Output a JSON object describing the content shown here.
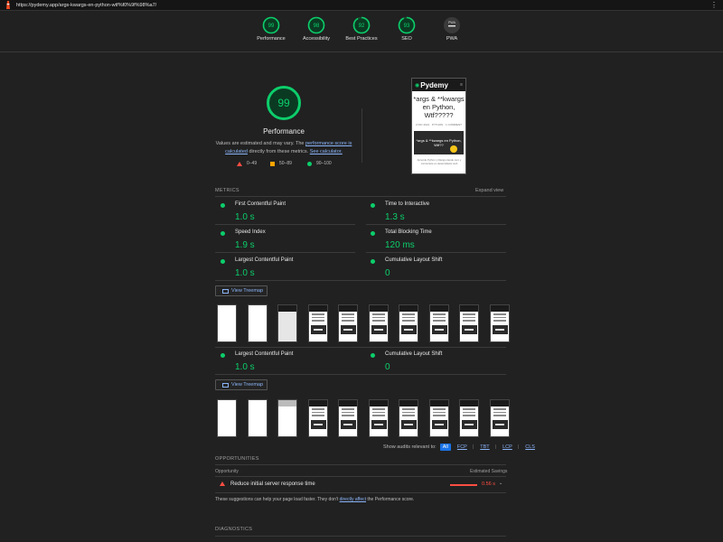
{
  "browser": {
    "url": "https://pydemy.app/args-kwargs-en-python-wtf%f0%9f%98%a7/"
  },
  "colors": {
    "pass": "#0cce6b",
    "average": "#ffa400",
    "fail": "#ff4e42",
    "link": "#8ab4f8",
    "bg": "#212121"
  },
  "gauges": [
    {
      "score": "99",
      "label": "Performance",
      "value": 99
    },
    {
      "score": "98",
      "label": "Accessibility",
      "value": 98
    },
    {
      "score": "92",
      "label": "Best Practices",
      "value": 92
    },
    {
      "score": "93",
      "label": "SEO",
      "value": 93
    },
    {
      "score": "",
      "label": "PWA",
      "badge": "PWA"
    }
  ],
  "performance": {
    "score": "99",
    "value": 99,
    "title": "Performance",
    "desc_1": "Values are estimated and may vary. The ",
    "desc_link_1": "performance score is calculated",
    "desc_2": " directly from these metrics. ",
    "desc_link_2": "See calculator.",
    "legend": [
      "0–49",
      "50–89",
      "90–100"
    ]
  },
  "screenshot": {
    "brand": "Pydemy",
    "title": "*args & **kwargs en Python, Wtf?????",
    "meta": "2 DIC 2021 · PYTHON · 1 COMMENT",
    "banner": "*args & **kwargs en Python, Wtf??",
    "footer": "Aprende Python y Django desde cero y conviértete en desarrollador web"
  },
  "metrics_section": {
    "label": "METRICS",
    "expand": "Expand view"
  },
  "metrics": [
    {
      "name": "First Contentful Paint",
      "value": "1.0 s"
    },
    {
      "name": "Time to Interactive",
      "value": "1.3 s"
    },
    {
      "name": "Speed Index",
      "value": "1.9 s"
    },
    {
      "name": "Total Blocking Time",
      "value": "120 ms"
    },
    {
      "name": "Largest Contentful Paint",
      "value": "1.0 s"
    },
    {
      "name": "Cumulative Layout Shift",
      "value": "0"
    }
  ],
  "metrics_repeat": [
    {
      "name": "Largest Contentful Paint",
      "value": "1.0 s"
    },
    {
      "name": "Cumulative Layout Shift",
      "value": "0"
    }
  ],
  "treemap_label": "View Treemap",
  "filter": {
    "label": "Show audits relevant to:",
    "chips": [
      "All",
      "FCP",
      "TBT",
      "LCP",
      "CLS"
    ]
  },
  "opportunities": {
    "label": "OPPORTUNITIES",
    "col_left": "Opportunity",
    "col_right": "Estimated Savings",
    "items": [
      {
        "name": "Reduce initial server response time",
        "savings": "0.56 s"
      }
    ],
    "note_1": "These suggestions can help your page load faster. They don't ",
    "note_link": "directly affect",
    "note_2": " the Performance score."
  },
  "diagnostics_label": "DIAGNOSTICS"
}
